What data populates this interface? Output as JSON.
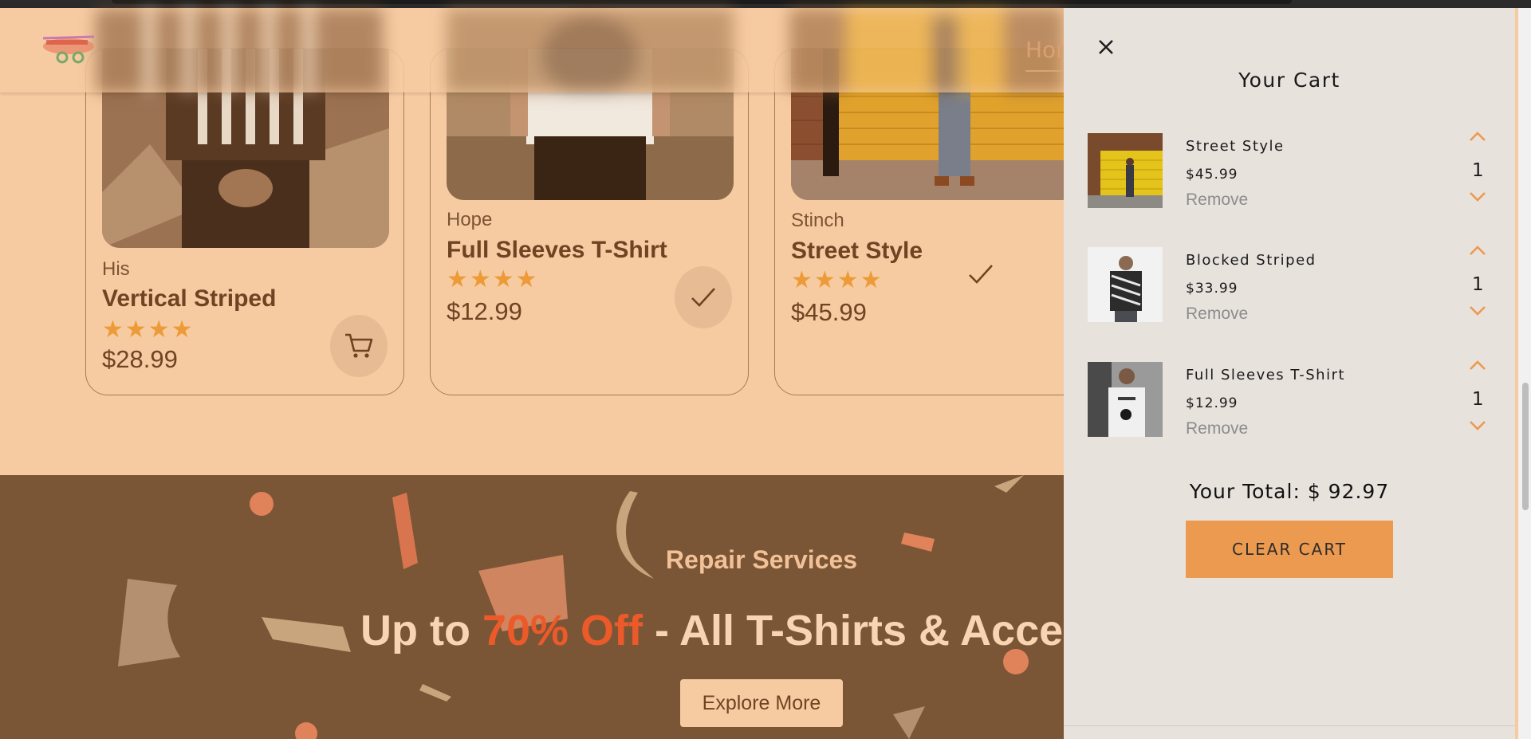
{
  "header": {
    "nav_home": "Hom"
  },
  "products": [
    {
      "brand": "His",
      "title": "Vertical Striped",
      "stars": "★★★★",
      "rating": 4,
      "price": "$28.99",
      "action": "cart-icon"
    },
    {
      "brand": "Hope",
      "title": "Full Sleeves T-Shirt",
      "stars": "★★★★",
      "rating": 4,
      "price": "$12.99",
      "action": "check-icon"
    },
    {
      "brand": "Stinch",
      "title": "Street Style",
      "stars": "★★★★",
      "rating": 4,
      "price": "$45.99",
      "action": "check-icon"
    }
  ],
  "promo": {
    "subtitle": "Repair Services",
    "headline_before": "Up to ",
    "headline_accent": "70% Off",
    "headline_after": " - All T-Shirts & Access",
    "button": "Explore More"
  },
  "cart": {
    "title": "Your Cart",
    "items": [
      {
        "name": "Street Style",
        "price": "$45.99",
        "qty": "1",
        "remove": "Remove"
      },
      {
        "name": "Blocked Striped",
        "price": "$33.99",
        "qty": "1",
        "remove": "Remove"
      },
      {
        "name": "Full Sleeves T-Shirt",
        "price": "$12.99",
        "qty": "1",
        "remove": "Remove"
      }
    ],
    "total": "Your Total: $ 92.97",
    "clear_button": "CLEAR CART"
  },
  "colors": {
    "page_bg": "#f7cba2",
    "promo_bg": "#7a5637",
    "accent_orange": "#ec9a4f",
    "star": "#ec9b38",
    "promo_accent": "#ed5a2a",
    "cart_bg": "#e8e2dd"
  }
}
